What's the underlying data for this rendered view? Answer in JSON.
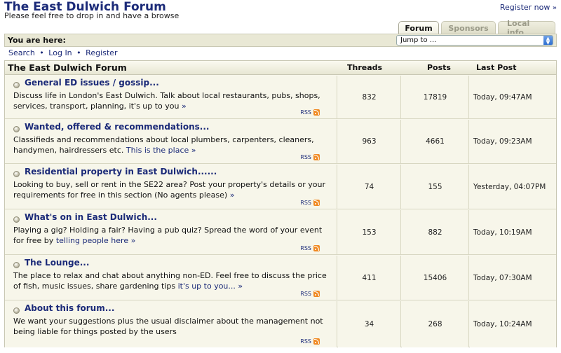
{
  "header": {
    "title": "The East Dulwich Forum",
    "tagline": "Please feel free to drop in and have a browse",
    "register_label": "Register now",
    "register_arrow": "»"
  },
  "tabs": [
    {
      "label": "Forum",
      "active": true
    },
    {
      "label": "Sponsors",
      "active": false
    },
    {
      "label": "Local info",
      "active": false
    }
  ],
  "breadcrumb": {
    "label": "You are here:",
    "jump_select_value": "Jump to ..."
  },
  "toplinks": {
    "search": "Search",
    "login": "Log In",
    "register": "Register",
    "separator": "•"
  },
  "table": {
    "headers": {
      "forum": "The East Dulwich Forum",
      "threads": "Threads",
      "posts": "Posts",
      "last_post": "Last Post"
    },
    "rss_label": "RSS",
    "rows": [
      {
        "name": "General ED issues / gossip...",
        "desc": "Discuss life in London's East Dulwich. Talk about local restaurants, pubs, shops, services, transport, planning, it's up to you",
        "more": "»",
        "threads": "832",
        "posts": "17819",
        "last_post": "Today, 09:47AM"
      },
      {
        "name": "Wanted, offered & recommendations...",
        "desc": "Classifieds and recommendations about local plumbers, carpenters, cleaners, handymen, hairdressers etc.",
        "more": "This is the place »",
        "threads": "963",
        "posts": "4661",
        "last_post": "Today, 09:23AM"
      },
      {
        "name": "Residential property in East Dulwich......",
        "desc": "Looking to buy, sell or rent in the SE22 area? Post your property's details or your requirements for free in this section (No agents please)",
        "more": "»",
        "threads": "74",
        "posts": "155",
        "last_post": "Yesterday, 04:07PM"
      },
      {
        "name": "What's on in East Dulwich...",
        "desc": "Playing a gig? Holding a fair? Having a pub quiz? Spread the word of your event for free by",
        "more": "telling people here »",
        "threads": "153",
        "posts": "882",
        "last_post": "Today, 10:19AM"
      },
      {
        "name": "The Lounge...",
        "desc": "The place to relax and chat about anything non-ED. Feel free to discuss the price of fish, music issues, share gardening tips",
        "more": "it's up to you... »",
        "threads": "411",
        "posts": "15406",
        "last_post": "Today, 07:30AM"
      },
      {
        "name": "About this forum...",
        "desc": "We want your suggestions plus the usual disclaimer about the management not being liable for things posted by the users",
        "more": "",
        "threads": "34",
        "posts": "268",
        "last_post": "Today, 10:24AM"
      }
    ]
  }
}
